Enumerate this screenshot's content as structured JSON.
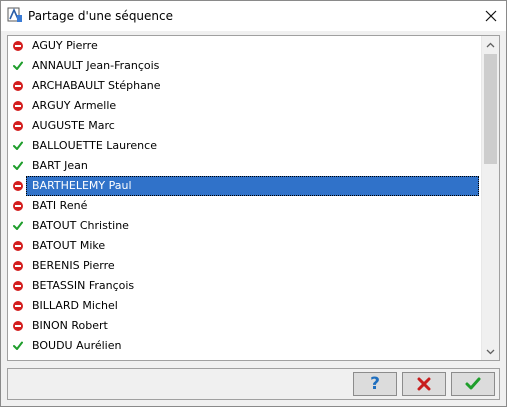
{
  "window": {
    "title": "Partage d'une séquence",
    "close_icon": "close-icon",
    "app_icon": "app-icon"
  },
  "list": {
    "items": [
      {
        "name": "AGUY Pierre",
        "status": "ban"
      },
      {
        "name": "ANNAULT Jean-François",
        "status": "check"
      },
      {
        "name": "ARCHABAULT Stéphane",
        "status": "ban"
      },
      {
        "name": "ARGUY Armelle",
        "status": "ban"
      },
      {
        "name": "AUGUSTE Marc",
        "status": "ban"
      },
      {
        "name": "BALLOUETTE Laurence",
        "status": "check"
      },
      {
        "name": "BART Jean",
        "status": "check"
      },
      {
        "name": "BARTHELEMY Paul",
        "status": "ban",
        "selected": true
      },
      {
        "name": "BATI René",
        "status": "ban"
      },
      {
        "name": "BATOUT Christine",
        "status": "check"
      },
      {
        "name": "BATOUT Mike",
        "status": "ban"
      },
      {
        "name": "BERENIS Pierre",
        "status": "ban"
      },
      {
        "name": "BETASSIN François",
        "status": "ban"
      },
      {
        "name": "BILLARD Michel",
        "status": "ban"
      },
      {
        "name": "BINON Robert",
        "status": "ban"
      },
      {
        "name": "BOUDU Aurélien",
        "status": "check"
      }
    ]
  },
  "footer": {
    "help_icon": "question-mark-icon",
    "help_label": "?",
    "cancel_icon": "red-x-icon",
    "ok_icon": "green-check-icon"
  },
  "colors": {
    "selection": "#3072c9",
    "ban": "#d41e1e",
    "check": "#1f9e2c",
    "cancel": "#c81e1e",
    "help": "#1f6fbf"
  }
}
